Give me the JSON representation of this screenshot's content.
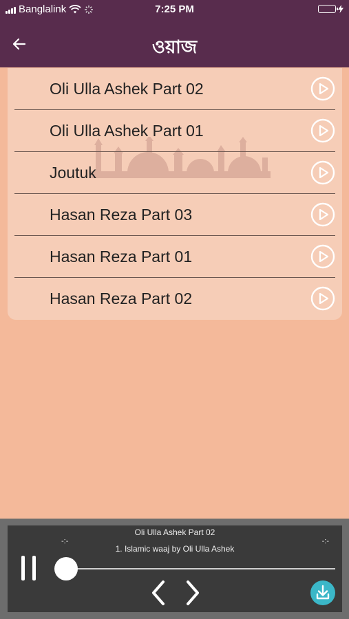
{
  "status_bar": {
    "carrier": "Banglalink",
    "time": "7:25 PM"
  },
  "header": {
    "title": "ওয়াজ"
  },
  "list": {
    "items": [
      {
        "title": "Oli Ulla Ashek Part 02"
      },
      {
        "title": "Oli Ulla Ashek Part 01"
      },
      {
        "title": "Joutuk"
      },
      {
        "title": "Hasan Reza Part 03"
      },
      {
        "title": "Hasan Reza Part 01"
      },
      {
        "title": "Hasan Reza Part 02"
      }
    ]
  },
  "player": {
    "title": "Oli Ulla Ashek Part 02",
    "subtitle": "1. Islamic waaj by Oli Ulla Ashek",
    "elapsed": "-:-",
    "remaining": "-:-",
    "progress": 0
  },
  "colors": {
    "header": "#582c4d",
    "background": "#f4b99a",
    "player": "#3a3a3a",
    "download": "#3bb7c8",
    "battery": "#4cd964"
  },
  "icons": [
    "back-arrow-icon",
    "play-circle-icon",
    "pause-icon",
    "previous-icon",
    "next-icon",
    "download-icon",
    "wifi-icon",
    "signal-icon",
    "battery-icon"
  ]
}
